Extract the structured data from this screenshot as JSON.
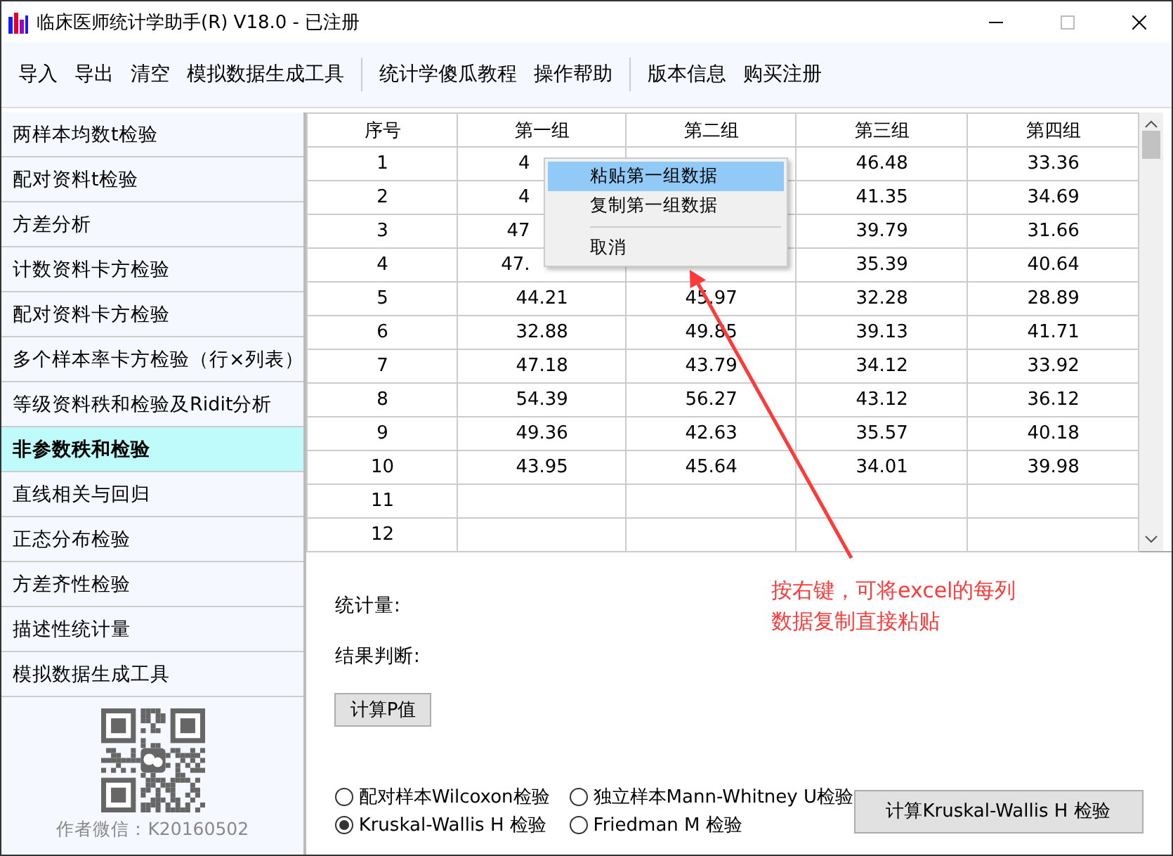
{
  "window": {
    "title": "临床医师统计学助手(R) V18.0 - 已注册"
  },
  "toolbar": {
    "groups": [
      [
        "导入",
        "导出",
        "清空",
        "模拟数据生成工具"
      ],
      [
        "统计学傻瓜教程",
        "操作帮助"
      ],
      [
        "版本信息",
        "购买注册"
      ]
    ]
  },
  "sidebar": {
    "items": [
      {
        "label": "两样本均数t检验",
        "selected": false
      },
      {
        "label": "配对资料t检验",
        "selected": false
      },
      {
        "label": "方差分析",
        "selected": false
      },
      {
        "label": "计数资料卡方检验",
        "selected": false
      },
      {
        "label": "配对资料卡方检验",
        "selected": false
      },
      {
        "label": "多个样本率卡方检验（行×列表）",
        "selected": false
      },
      {
        "label": "等级资料秩和检验及Ridit分析",
        "selected": false
      },
      {
        "label": "非参数秩和检验",
        "selected": true
      },
      {
        "label": "直线相关与回归",
        "selected": false
      },
      {
        "label": "正态分布检验",
        "selected": false
      },
      {
        "label": "方差齐性检验",
        "selected": false
      },
      {
        "label": "描述性统计量",
        "selected": false
      },
      {
        "label": "模拟数据生成工具",
        "selected": false
      }
    ],
    "author": "作者微信：K20160502"
  },
  "table": {
    "columns": [
      "序号",
      "第一组",
      "第二组",
      "第三组",
      "第四组"
    ],
    "rows": [
      [
        "1",
        "4",
        null,
        "46.48",
        "33.36"
      ],
      [
        "2",
        "4",
        null,
        "41.35",
        "34.69"
      ],
      [
        "3",
        "47",
        null,
        "39.79",
        "31.66"
      ],
      [
        "4",
        "47.",
        null,
        "35.39",
        "40.64"
      ],
      [
        "5",
        "44.21",
        "45.97",
        "32.28",
        "28.89"
      ],
      [
        "6",
        "32.88",
        "49.85",
        "39.13",
        "41.71"
      ],
      [
        "7",
        "47.18",
        "43.79",
        "34.12",
        "33.92"
      ],
      [
        "8",
        "54.39",
        "56.27",
        "43.12",
        "36.12"
      ],
      [
        "9",
        "49.36",
        "42.63",
        "35.57",
        "40.18"
      ],
      [
        "10",
        "43.95",
        "45.64",
        "34.01",
        "39.98"
      ],
      [
        "11",
        null,
        null,
        null,
        null
      ],
      [
        "12",
        null,
        null,
        null,
        null
      ]
    ]
  },
  "context_menu": {
    "items": [
      {
        "label": "粘贴第一组数据",
        "selected": true
      },
      {
        "label": "复制第一组数据",
        "selected": false
      },
      {
        "label": "取消",
        "selected": false
      }
    ]
  },
  "annotation": [
    "按右键，可将excel的每列",
    "数据复制直接粘贴"
  ],
  "results": {
    "statistic_label": "统计量:",
    "judgement_label": "结果判断:",
    "p_button": "计算P值"
  },
  "methods": [
    {
      "label": "配对样本Wilcoxon检验",
      "selected": false
    },
    {
      "label": "独立样本Mann-Whitney U检验",
      "selected": false
    },
    {
      "label": "Kruskal-Wallis H 检验",
      "selected": true
    },
    {
      "label": "Friedman M 检验",
      "selected": false
    }
  ],
  "run_button": "计算Kruskal-Wallis H 检验"
}
